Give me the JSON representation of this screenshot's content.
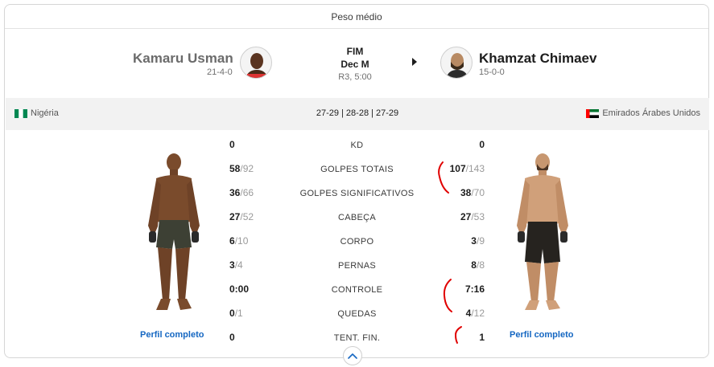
{
  "weight_class": "Peso médio",
  "red_corner": {
    "name": "Kamaru Usman",
    "record": "21-4-0",
    "country": "Nigéria",
    "profile_link": "Perfil completo"
  },
  "blue_corner": {
    "name": "Khamzat Chimaev",
    "record": "15-0-0",
    "country": "Emirados Árabes Unidos",
    "profile_link": "Perfil completo"
  },
  "result": {
    "label": "FIM",
    "method": "Dec M",
    "round_time": "R3, 5:00"
  },
  "scorecards": "27-29 | 28-28 | 27-29",
  "stats": [
    {
      "label": "KD",
      "left_num": "0",
      "left_den": "",
      "right_num": "0",
      "right_den": ""
    },
    {
      "label": "GOLPES TOTAIS",
      "left_num": "58",
      "left_den": "/92",
      "right_num": "107",
      "right_den": "/143"
    },
    {
      "label": "GOLPES SIGNIFICATIVOS",
      "left_num": "36",
      "left_den": "/66",
      "right_num": "38",
      "right_den": "/70"
    },
    {
      "label": "CABEÇA",
      "left_num": "27",
      "left_den": "/52",
      "right_num": "27",
      "right_den": "/53"
    },
    {
      "label": "CORPO",
      "left_num": "6",
      "left_den": "/10",
      "right_num": "3",
      "right_den": "/9"
    },
    {
      "label": "PERNAS",
      "left_num": "3",
      "left_den": "/4",
      "right_num": "8",
      "right_den": "/8"
    },
    {
      "label": "CONTROLE",
      "left_num": "0:00",
      "left_den": "",
      "right_num": "7:16",
      "right_den": ""
    },
    {
      "label": "QUEDAS",
      "left_num": "0",
      "left_den": "/1",
      "right_num": "4",
      "right_den": "/12"
    },
    {
      "label": "TENT. FIN.",
      "left_num": "0",
      "left_den": "",
      "right_num": "1",
      "right_den": ""
    }
  ],
  "icons": {
    "winner": "winner-arrow-icon",
    "expand": "chevron-up-icon",
    "left_flag": "nigeria-flag-icon",
    "right_flag": "uae-flag-icon"
  },
  "colors": {
    "link": "#1567c2",
    "annotation": "#e00000"
  }
}
